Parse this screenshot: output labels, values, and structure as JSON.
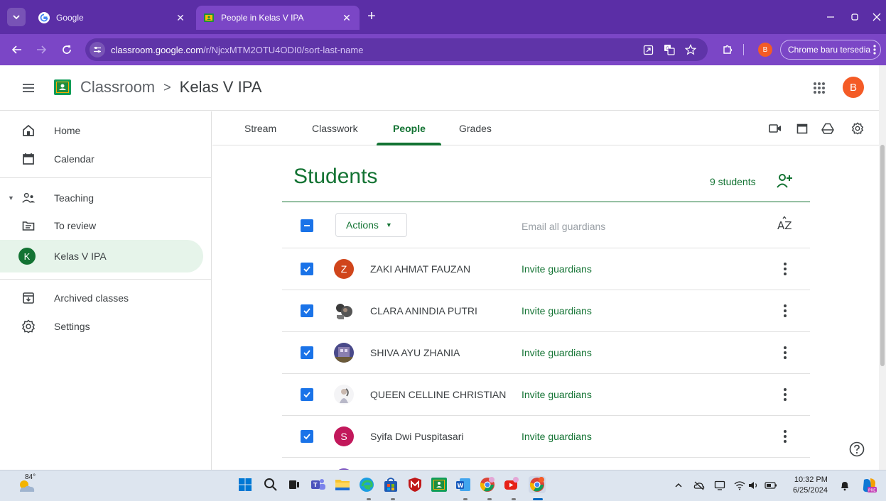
{
  "browser": {
    "tabs": [
      {
        "title": "Google",
        "active": false
      },
      {
        "title": "People in Kelas V IPA",
        "active": true
      }
    ],
    "url_host": "classroom.google.com",
    "url_path": "/r/NjcxMTM2OTU4ODI0/sort-last-name",
    "profile_initial": "B",
    "update_label": "Chrome baru tersedia",
    "accent_color": "#7b46c6"
  },
  "app": {
    "name": "Classroom",
    "class_name": "Kelas V IPA",
    "account_initial": "B",
    "brand_color": "#137333"
  },
  "sidebar": {
    "items": [
      {
        "label": "Home",
        "icon": "home-icon"
      },
      {
        "label": "Calendar",
        "icon": "calendar-icon"
      },
      {
        "label": "Teaching",
        "icon": "teaching-icon"
      },
      {
        "label": "To review",
        "icon": "to-review-icon"
      },
      {
        "label": "Kelas V IPA",
        "avatar": "K",
        "selected": true
      },
      {
        "label": "Archived classes",
        "icon": "archive-icon"
      },
      {
        "label": "Settings",
        "icon": "settings-icon"
      }
    ]
  },
  "main_tabs": [
    {
      "label": "Stream"
    },
    {
      "label": "Classwork"
    },
    {
      "label": "People",
      "active": true
    },
    {
      "label": "Grades"
    }
  ],
  "students": {
    "heading": "Students",
    "count_label": "9 students",
    "actions_label": "Actions",
    "email_guardians_label": "Email all guardians",
    "invite_label": "Invite guardians",
    "rows": [
      {
        "name": "ZAKI AHMAT FAUZAN",
        "avatar_letter": "Z",
        "avatar_color": "#d0451b",
        "checked": true
      },
      {
        "name": "CLARA ANINDIA PUTRI",
        "avatar_photo": true,
        "checked": true
      },
      {
        "name": "SHIVA AYU ZHANIA",
        "avatar_photo": true,
        "checked": true
      },
      {
        "name": "QUEEN CELLINE CHRISTIAN",
        "avatar_photo": true,
        "checked": true
      },
      {
        "name": "Syifa Dwi Puspitasari",
        "avatar_letter": "S",
        "avatar_color": "#c2185b",
        "checked": true
      }
    ]
  },
  "taskbar": {
    "weather_temp": "84°",
    "time": "10:32 PM",
    "date": "6/25/2024"
  }
}
